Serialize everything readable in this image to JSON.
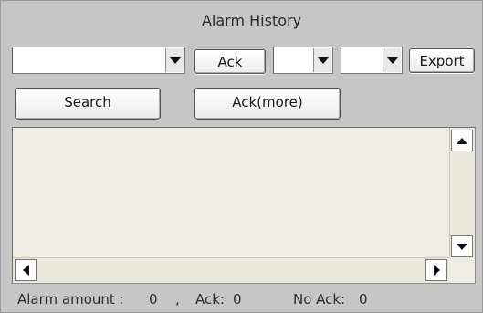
{
  "window": {
    "title": "Alarm History"
  },
  "toolbar": {
    "filter_value": "",
    "ack_label": "Ack",
    "combo2_value": "",
    "combo3_value": "",
    "export_label": "Export",
    "search_label": "Search",
    "ack_more_label": "Ack(more)"
  },
  "status": {
    "amount_label": "Alarm amount :",
    "amount_value": "0",
    "separator": ",",
    "ack_label": "Ack:",
    "ack_value": "0",
    "noack_label": "No Ack:",
    "noack_value": "0"
  },
  "icons": {
    "dropdown": "chevron-down-icon",
    "scroll_up": "arrow-up-icon",
    "scroll_down": "arrow-down-icon",
    "scroll_left": "arrow-left-icon",
    "scroll_right": "arrow-right-icon"
  },
  "colors": {
    "panel_bg": "#c6c6c6",
    "list_bg": "#efede1",
    "button_border": "#555555"
  }
}
